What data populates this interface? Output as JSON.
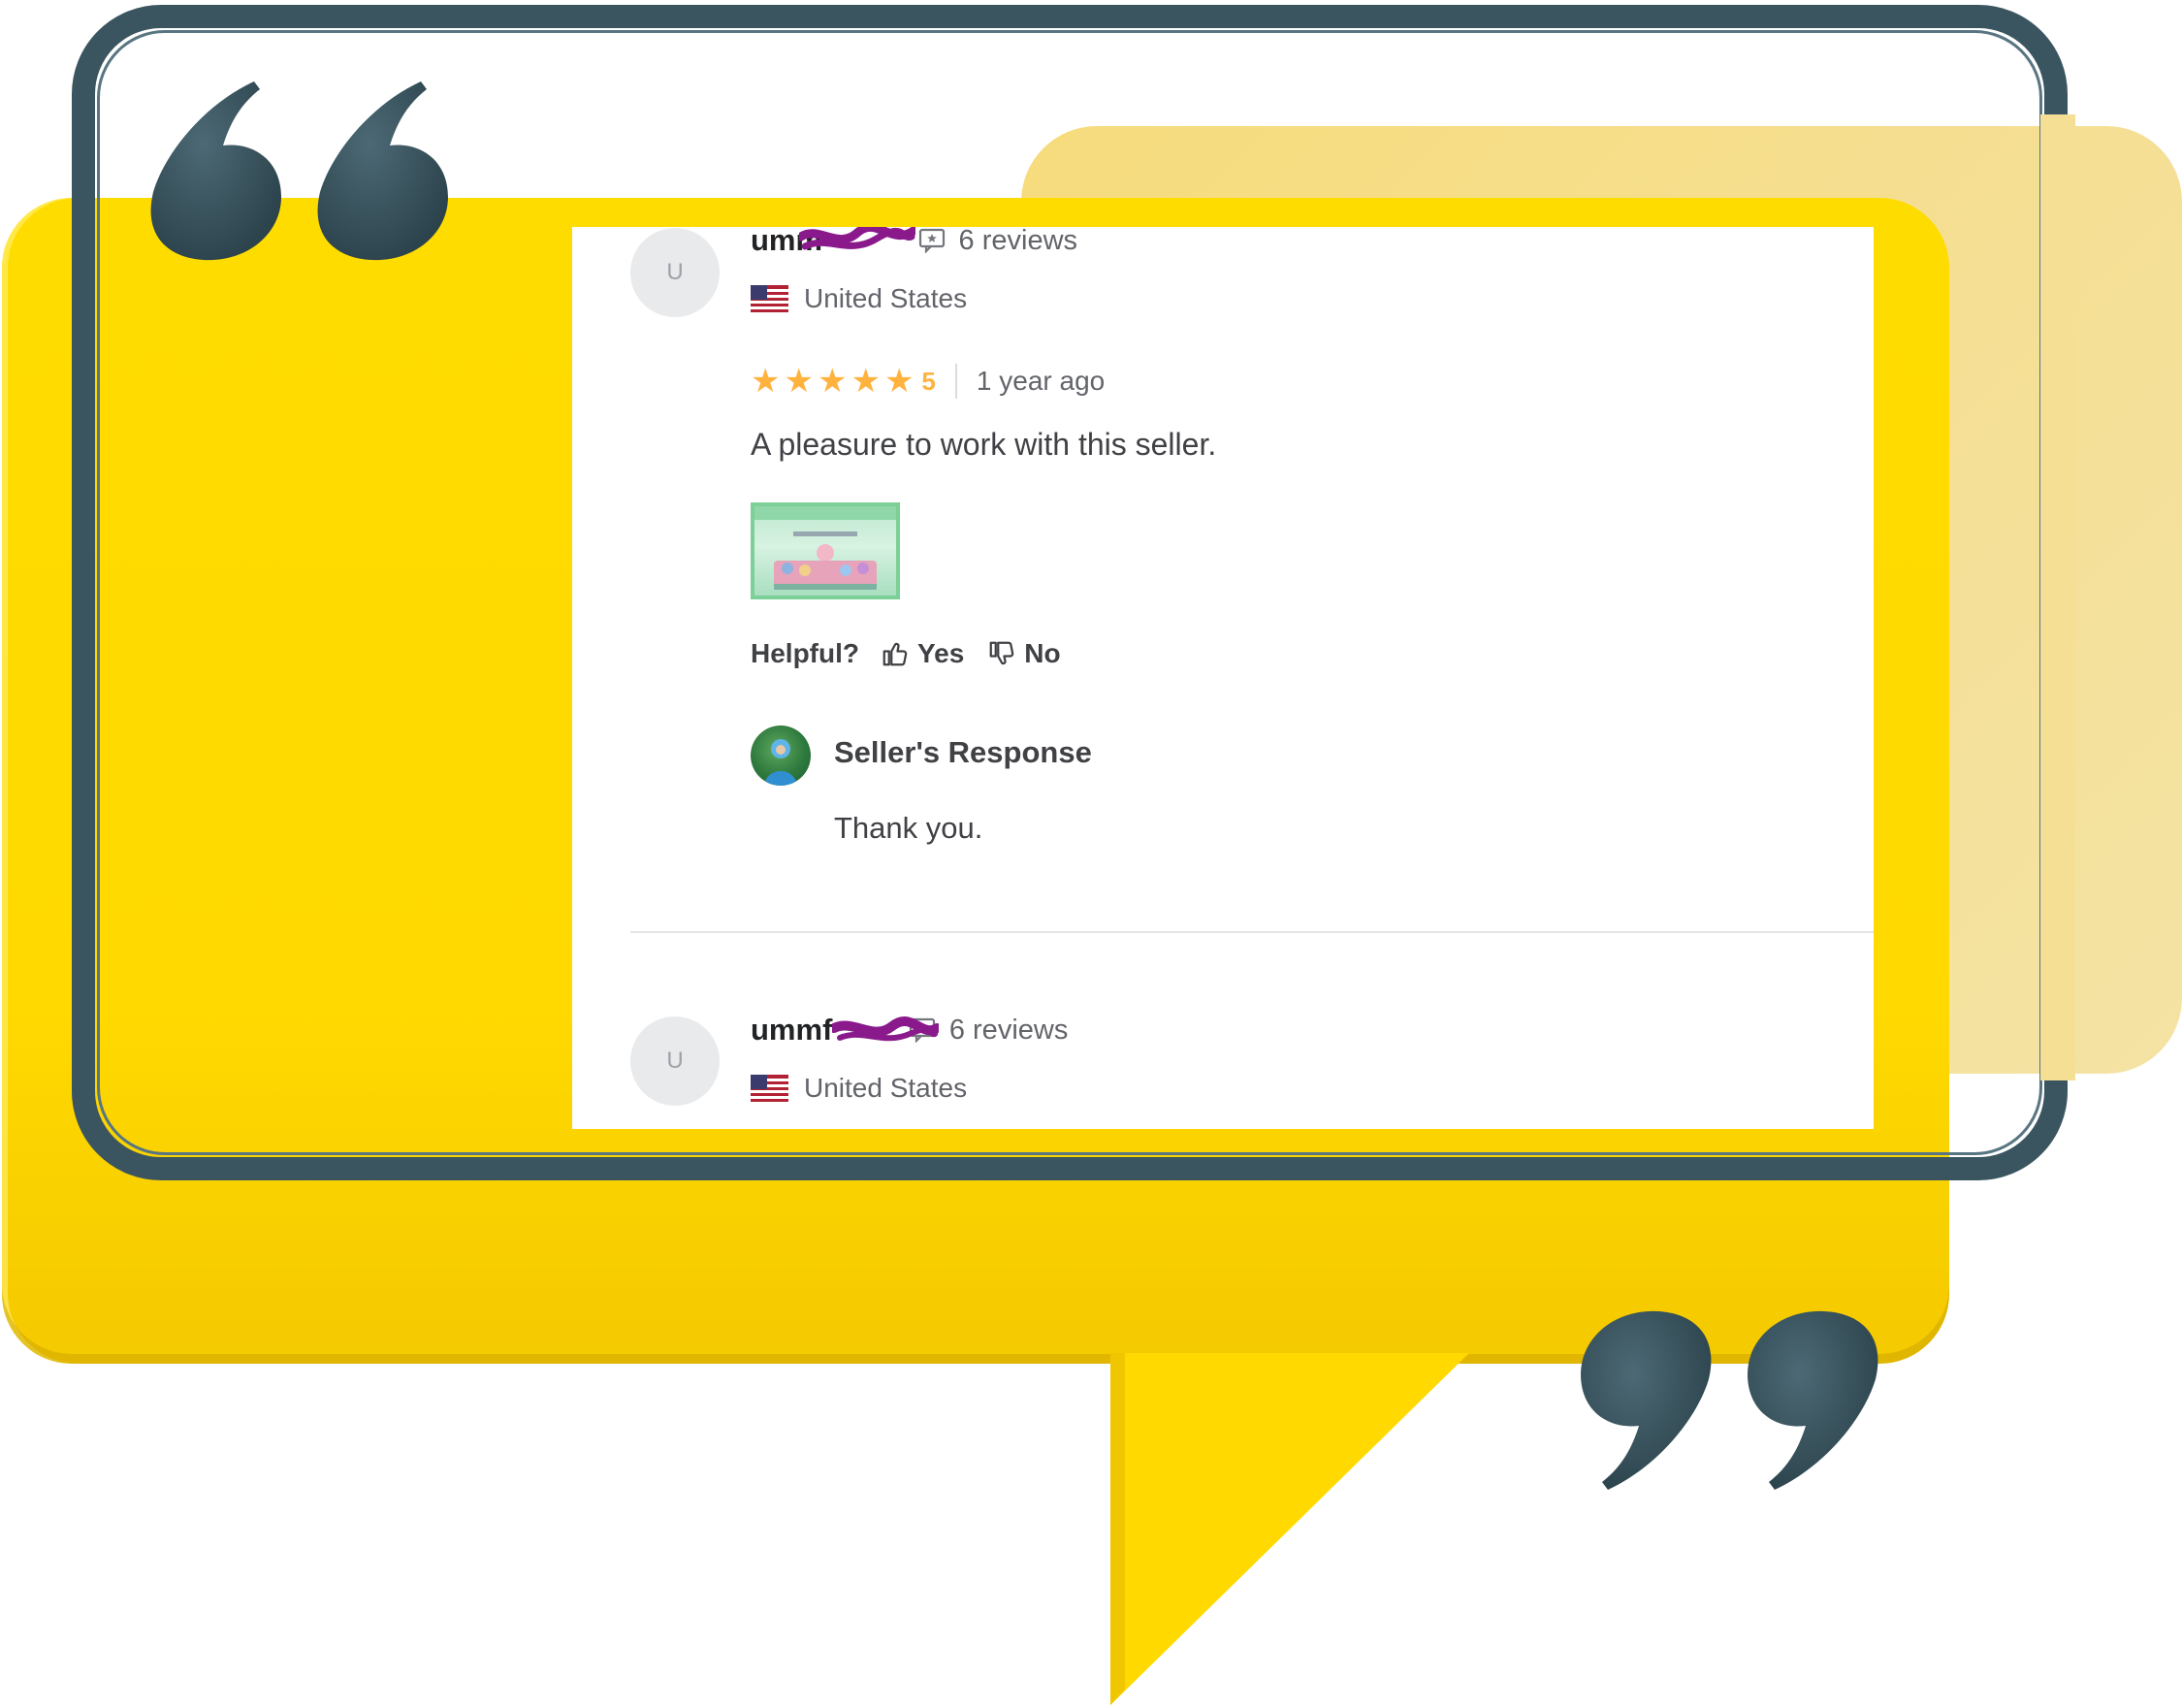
{
  "colors": {
    "bubble_yellow": "#ffd900",
    "bubble_pale": "#f5df95",
    "frame_dark": "#3a5560",
    "star_orange": "#ffb33e",
    "redaction_purple": "#8a1a8c"
  },
  "reviews": [
    {
      "avatar_initial": "U",
      "username": "umm",
      "reviews_count": "6 reviews",
      "country": "United States",
      "rating": "5",
      "time_ago": "1 year ago",
      "text": "A pleasure to work with this seller.",
      "helpful_label": "Helpful?",
      "yes_label": "Yes",
      "no_label": "No",
      "seller_response": {
        "title": "Seller's Response",
        "text": "Thank you."
      }
    },
    {
      "avatar_initial": "U",
      "username": "ummf",
      "reviews_count": "6 reviews",
      "country": "United States"
    }
  ],
  "icons": {
    "quote_open": "double-quote-open-icon",
    "quote_close": "double-quote-close-icon",
    "reviews": "review-badge-icon",
    "flag": "us-flag-icon",
    "star": "star-icon",
    "thumbs_up": "thumbs-up-icon",
    "thumbs_down": "thumbs-down-icon"
  }
}
